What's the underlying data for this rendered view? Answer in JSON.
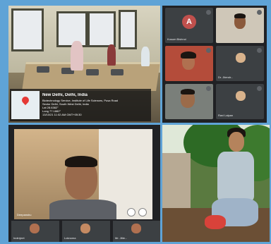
{
  "panel_top_left": {
    "geotag": {
      "title": "New Delhi, Delhi, India",
      "line1": "Biotechnology Service, Institute of Life Sciences, Pusa Road",
      "line2": "Sector Delhi, South West Delhi, India",
      "line3": "Lat 28.6382°",
      "line4": "Long 77.1882°",
      "line5": "13/10/21 11:02 AM GMT+05:30"
    }
  },
  "panel_top_right": {
    "participants": [
      {
        "name": "Kusum Bishnoi",
        "initial": "A",
        "type": "avatar",
        "color": "#c0504d"
      },
      {
        "name": "",
        "type": "video"
      },
      {
        "name": "",
        "type": "video"
      },
      {
        "name": "Dr. Jitendr...",
        "type": "video"
      },
      {
        "name": "",
        "type": "video"
      },
      {
        "name": "Ravi Lalpan",
        "type": "avatar"
      }
    ]
  },
  "panel_bottom_left": {
    "self_name": "Deepanshu",
    "bottom_participants": [
      {
        "name": "Inderjeet"
      },
      {
        "name": "Loknoma"
      },
      {
        "name": "Mr. Jitte..."
      }
    ]
  },
  "panel_bottom_right": {}
}
